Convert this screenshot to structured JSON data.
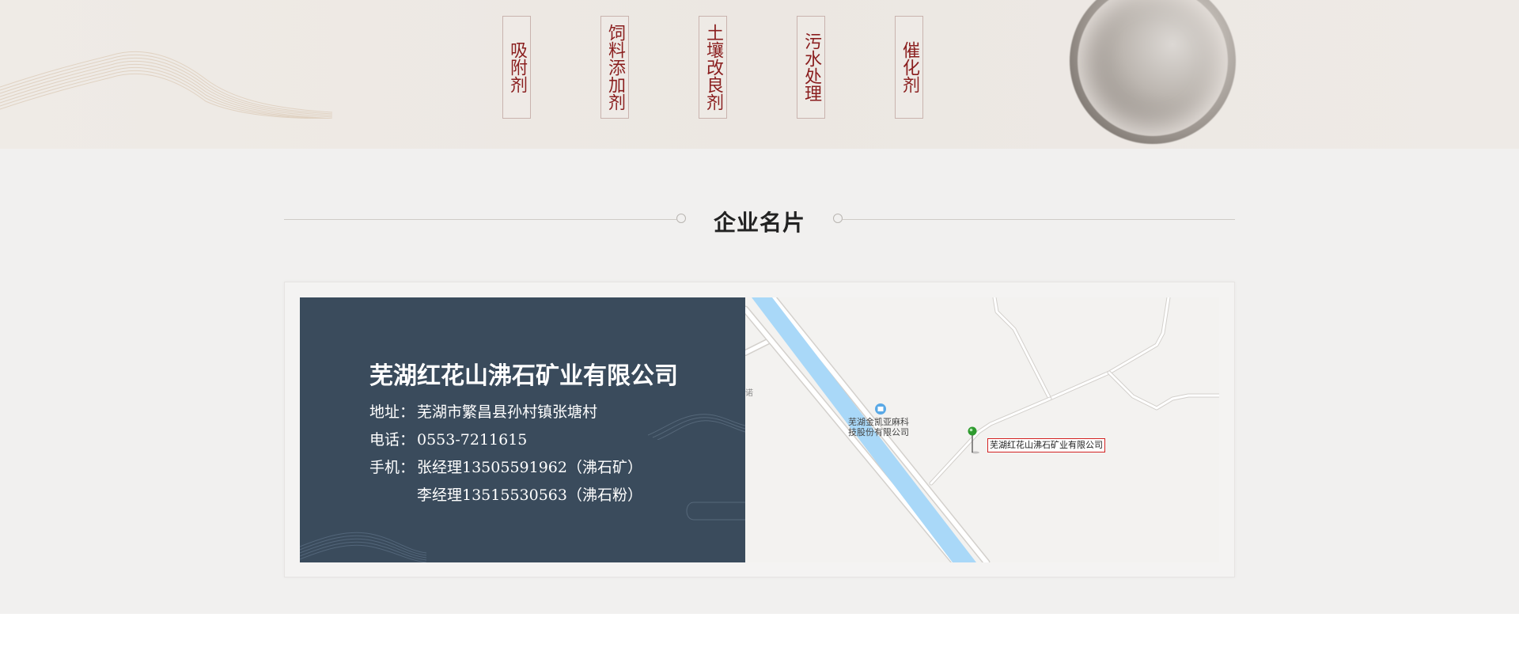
{
  "banner": {
    "tags": [
      "吸附剂",
      "饲料添加剂",
      "土壤改良剂",
      "污水处理",
      "催化剂"
    ]
  },
  "section": {
    "title": "企业名片"
  },
  "card": {
    "company": "芜湖红花山沸石矿业有限公司",
    "address_label": "地址：",
    "address": "芜湖市繁昌县孙村镇张塘村",
    "phone_label": "电话：",
    "phone": "0553-7211615",
    "mobile_label": "手机：",
    "mobile_1": "张经理13505591962（沸石矿）",
    "mobile_2": "李经理13515530563（沸石粉）"
  },
  "map": {
    "poi_line1": "芜湖金凯亚麻科",
    "poi_line2": "技股份有限公司",
    "marker_label": "芜湖红花山沸石矿业有限公司",
    "edge_text": "诺",
    "icons": [
      "poi-icon",
      "map-pin-icon"
    ],
    "colors": {
      "river": "#a9d8f8",
      "road": "#ffffff",
      "road_edge": "#d3d0cc",
      "marker_border": "#d32222"
    }
  },
  "colors": {
    "card_bg": "#3a4b5c",
    "tag_text": "#8a1e1e",
    "banner_bg": "#ece7e2",
    "section_bg": "#f1f0ef"
  }
}
